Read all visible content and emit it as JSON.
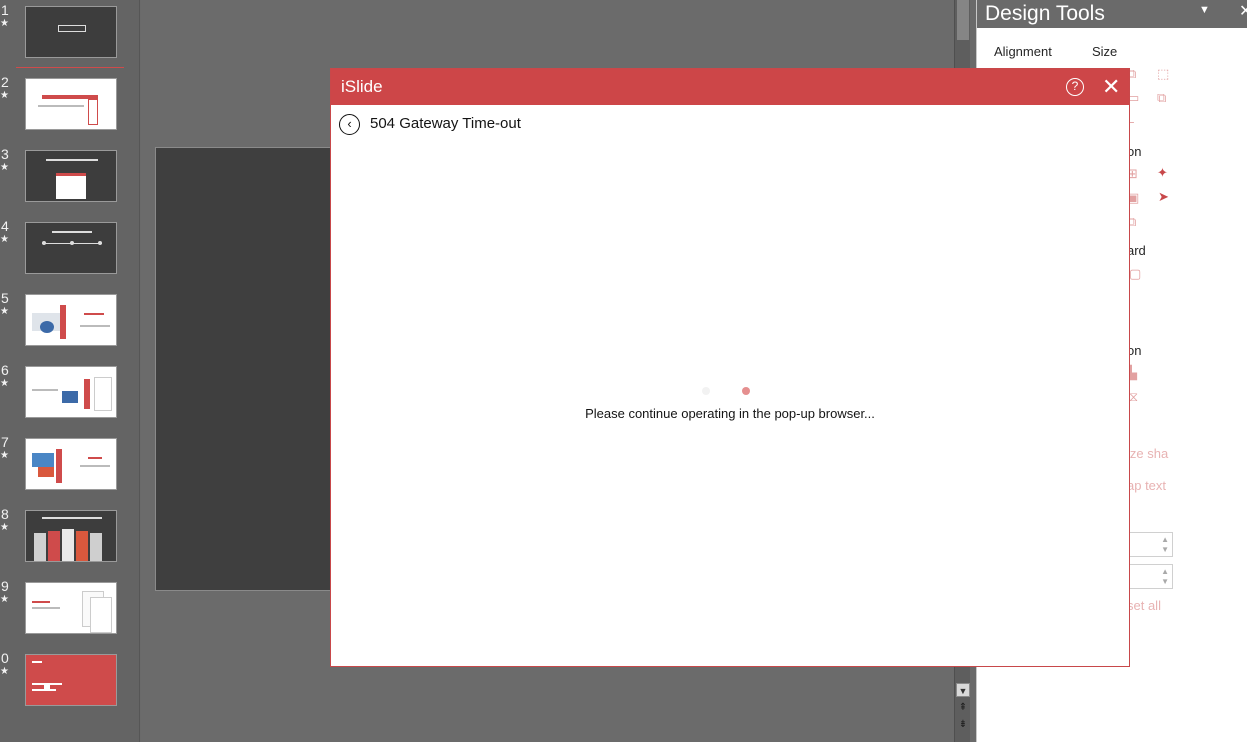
{
  "slides": [
    {
      "number": "1",
      "star": "★",
      "theme": "dark"
    },
    {
      "number": "2",
      "star": "★",
      "theme": "light"
    },
    {
      "number": "3",
      "star": "★",
      "theme": "dark"
    },
    {
      "number": "4",
      "star": "★",
      "theme": "dark"
    },
    {
      "number": "5",
      "star": "★",
      "theme": "light"
    },
    {
      "number": "6",
      "star": "★",
      "theme": "light"
    },
    {
      "number": "7",
      "star": "★",
      "theme": "light"
    },
    {
      "number": "8",
      "star": "★",
      "theme": "dark"
    },
    {
      "number": "9",
      "star": "★",
      "theme": "light"
    },
    {
      "number": "0",
      "star": "★",
      "theme": "red"
    }
  ],
  "design_tools": {
    "title": "Design Tools",
    "caret_icon": "chevron-down-icon",
    "close_glyph": "✕",
    "alignment_label": "Alignment",
    "size_label": "Size",
    "partial_label_1": "on",
    "partial_label_2": "ard",
    "partial_label_3": "on",
    "partial_label_4": "ize sha",
    "partial_label_5": "ap text",
    "partial_label_6": "set all"
  },
  "dialog": {
    "title": "iSlide",
    "help_glyph": "?",
    "close_glyph": "✕",
    "back_glyph": "‹",
    "error_text": "504 Gateway Time-out",
    "message": "Please continue operating in the pop-up browser...",
    "accent_color": "#cd4648"
  },
  "colors": {
    "accent": "#cd4648",
    "panel_bg": "#6a6a6a"
  }
}
